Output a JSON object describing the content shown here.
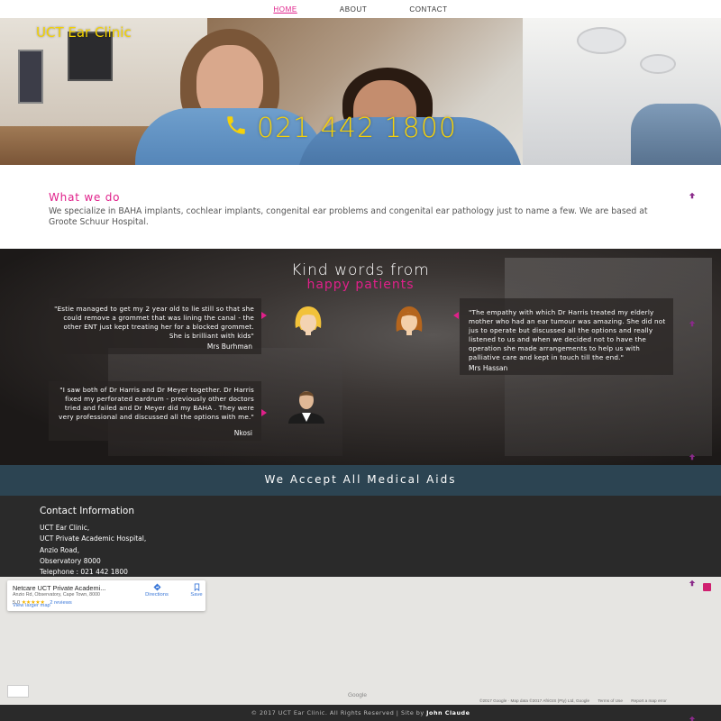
{
  "nav": {
    "items": [
      {
        "label": "HOME",
        "active": true
      },
      {
        "label": "ABOUT",
        "active": false
      },
      {
        "label": "CONTACT",
        "active": false
      }
    ],
    "active_color": "#e0208a"
  },
  "hero": {
    "brand": "UCT Ear Clinic",
    "phone": "021 442 1800",
    "phone_icon": "phone-icon",
    "accent_color": "#f3d200"
  },
  "what_we_do": {
    "heading": "What we do",
    "body": "We specialize in BAHA implants, cochlear implants, congenital ear problems and congenital ear pathology just to name a few. We are based at Groote Schuur Hospital."
  },
  "testimonials": {
    "heading": "Kind words from",
    "subheading": "happy patients",
    "items": [
      {
        "quote": "\"Estie managed to get my 2 year old to lie still so that she could remove a grommet that was lining the canal - the other ENT just kept treating her for a blocked grommet. She is brilliant with kids\"",
        "author": "Mrs Burhman",
        "avatar": "blonde-woman-avatar-icon"
      },
      {
        "quote": "\"The empathy with which Dr Harris treated my elderly mother who had an ear tumour was amazing. She did not jus to operate but discussed all the options and really listened to us and when we decided not to have the operation she made arrangements to help us with palliative care and kept in touch till the end.\"",
        "author": "Mrs Hassan",
        "avatar": "brunette-woman-avatar-icon"
      },
      {
        "quote": "\"I saw both of Dr Harris and Dr Meyer together. Dr Harris fixed my perforated eardrum - previously other doctors tried and failed and Dr Meyer did my BAHA . They were very professional and discussed all the options with me.\"",
        "author": "Nkosi",
        "avatar": "man-in-suit-avatar-icon"
      }
    ]
  },
  "medical_aids": {
    "label": "We Accept All Medical Aids"
  },
  "contact": {
    "heading": "Contact Information",
    "lines": [
      "UCT Ear Clinic,",
      "UCT Private Academic Hospital,",
      "Anzio Road,",
      "Observatory 8000",
      "Telephone : 021 442 1800"
    ]
  },
  "map": {
    "place_name": "Netcare UCT Private Academi...",
    "address": "Anzio Rd, Observatory, Cape Town, 8000",
    "rating": "5.0",
    "stars": "★★★★★",
    "reviews": "2 reviews",
    "view_larger": "View larger map",
    "directions": "Directions",
    "save": "Save",
    "google_logo": "Google",
    "attribution": [
      "©2017 Google · Map data ©2017 AfriGIS (Pty) Ltd, Google",
      "Terms of Use",
      "Report a map error"
    ]
  },
  "footer": {
    "text": "© 2017 UCT Ear Clinic. All Rights Reserved | Site by",
    "author": "John Claude"
  }
}
